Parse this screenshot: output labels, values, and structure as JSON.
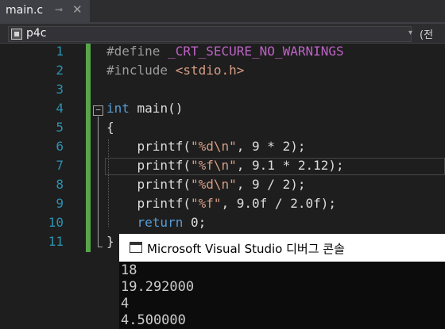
{
  "tab": {
    "title": "main.c",
    "pin_glyph": "⊸",
    "close_glyph": "✕"
  },
  "navbar": {
    "project": "p4c",
    "dropdown_glyph": "▾",
    "scope": "(전"
  },
  "editor": {
    "line_numbers": [
      "1",
      "2",
      "3",
      "4",
      "5",
      "6",
      "7",
      "8",
      "9",
      "10",
      "11"
    ],
    "fold_glyph": "−"
  },
  "code": {
    "l1_directive": "#define",
    "l1_macro": "_CRT_SECURE_NO_WARNINGS",
    "l2_directive": "#include",
    "l2_header": "<stdio.h>",
    "l4_kw": "int",
    "l4_rest": " main()",
    "l5": "{",
    "l6_fn": "    printf(",
    "l6_str": "\"%d\\n\"",
    "l6_rest": ", 9 * 2);",
    "l7_fn": "    printf(",
    "l7_str": "\"%f\\n\"",
    "l7_rest": ", 9.1 * 2.12);",
    "l8_fn": "    printf(",
    "l8_str": "\"%d\\n\"",
    "l8_rest": ", 9 / 2);",
    "l9_fn": "    printf(",
    "l9_str": "\"%f\"",
    "l9_rest": ", 9.0f / 2.0f);",
    "l10_kw": "    return",
    "l10_rest": " 0;",
    "l11": "}"
  },
  "console": {
    "title": "Microsoft Visual Studio 디버그 콘솔",
    "output": [
      "18",
      "19.292000",
      "4",
      "4.500000"
    ]
  }
}
